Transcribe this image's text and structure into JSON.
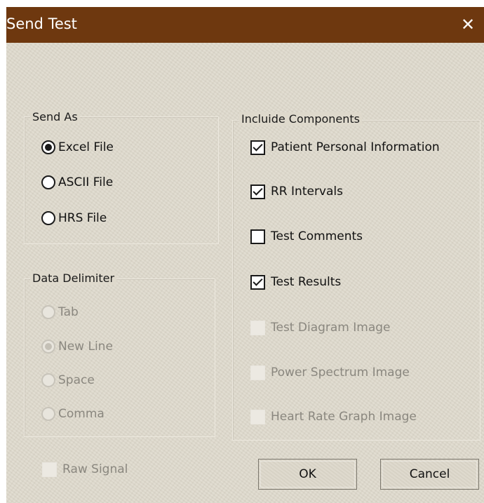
{
  "window": {
    "title": "Send Test"
  },
  "send_as": {
    "label": "Send As",
    "options": [
      {
        "label": "Excel File",
        "checked": true
      },
      {
        "label": "ASCII File",
        "checked": false
      },
      {
        "label": "HRS File",
        "checked": false
      }
    ]
  },
  "data_delimiter": {
    "label": "Data Delimiter",
    "enabled": false,
    "options": [
      {
        "label": "Tab",
        "checked": false
      },
      {
        "label": "New Line",
        "checked": true
      },
      {
        "label": "Space",
        "checked": false
      },
      {
        "label": "Comma",
        "checked": false
      }
    ]
  },
  "components": {
    "label": "Incluide Components",
    "items": [
      {
        "label": "Patient Personal Information",
        "checked": true,
        "enabled": true
      },
      {
        "label": "RR Intervals",
        "checked": true,
        "enabled": true
      },
      {
        "label": "Test Comments",
        "checked": false,
        "enabled": true
      },
      {
        "label": "Test Results",
        "checked": true,
        "enabled": true
      },
      {
        "label": "Test Diagram Image",
        "checked": false,
        "enabled": false
      },
      {
        "label": "Power Spectrum Image",
        "checked": false,
        "enabled": false
      },
      {
        "label": "Heart Rate Graph Image",
        "checked": false,
        "enabled": false
      }
    ]
  },
  "raw_signal": {
    "label": "Raw Signal",
    "checked": false,
    "enabled": false
  },
  "buttons": {
    "ok": "OK",
    "cancel": "Cancel"
  },
  "colors": {
    "titlebar": "#6e380f",
    "dialog_bg": "#ded9cc",
    "disabled_text": "#8a877f"
  }
}
